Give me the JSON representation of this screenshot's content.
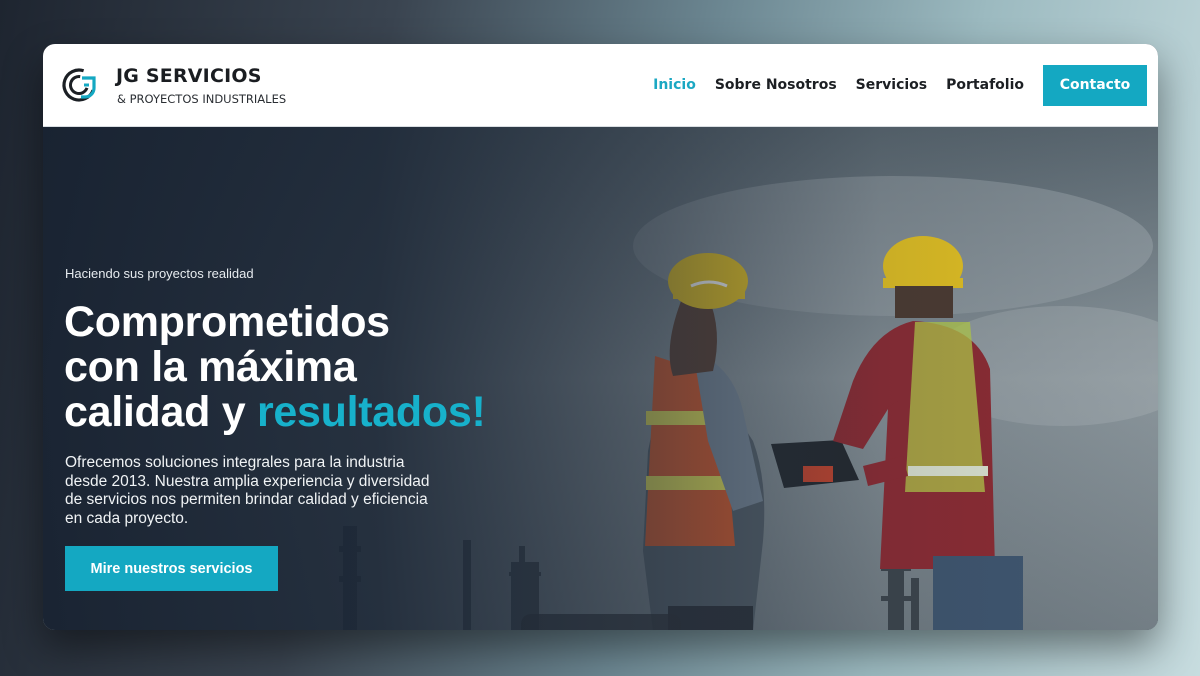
{
  "brand": {
    "name": "JG SERVICIOS",
    "subtitle": "& PROYECTOS INDUSTRIALES",
    "logo_icon": "jg-logo-icon"
  },
  "nav": {
    "items": [
      {
        "label": "Inicio",
        "active": true
      },
      {
        "label": "Sobre Nosotros",
        "active": false
      },
      {
        "label": "Servicios",
        "active": false
      },
      {
        "label": "Portafolio",
        "active": false
      }
    ],
    "cta_label": "Contacto"
  },
  "hero": {
    "tagline": "Haciendo sus proyectos realidad",
    "headline_line1": "Comprometidos",
    "headline_line2": "con la máxima",
    "headline_line3": "calidad y ",
    "headline_accent": "resultados!",
    "description": "Ofrecemos soluciones integrales para la industria desde 2013. Nuestra amplia experiencia y diversidad de servicios nos permiten brindar calidad y eficiencia en cada proyecto.",
    "cta_label": "Mire nuestros servicios"
  },
  "colors": {
    "accent": "#14a8c2",
    "nav_active": "#1ca8c3",
    "hero_overlay": "#172130",
    "text_dark": "#1c1f23"
  }
}
